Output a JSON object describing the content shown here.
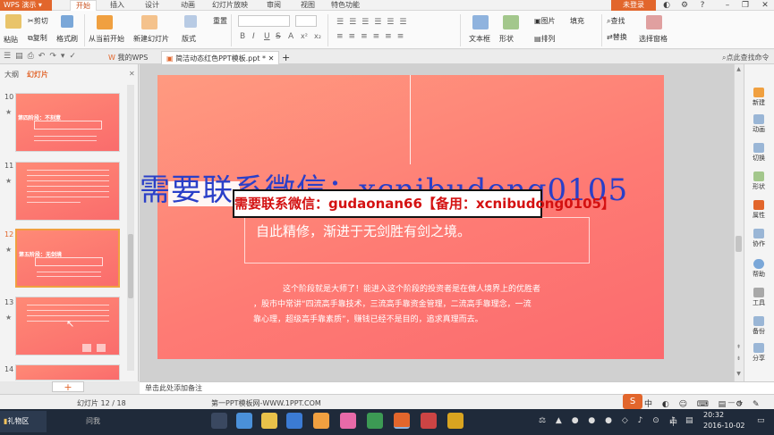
{
  "app": {
    "name": "WPS 演示",
    "menu_tabs": [
      "开始",
      "插入",
      "设计",
      "动画",
      "幻灯片放映",
      "审阅",
      "视图",
      "特色功能"
    ],
    "login_label": "未登录"
  },
  "ribbon": {
    "paste": "粘贴",
    "cut": "剪切",
    "copy": "复制",
    "format_painter": "格式刷",
    "from_current": "从当前开始",
    "new_slide": "新建幻灯片",
    "layout": "版式",
    "reset": "重置",
    "text_box": "文本框",
    "shape": "形状",
    "arrange": "排列",
    "image": "图片",
    "fill": "填充",
    "find": "查找",
    "replace": "替换",
    "select_window": "选择窗格",
    "font_buttons": [
      "B",
      "I",
      "U",
      "S",
      "A",
      "x²",
      "x₂"
    ]
  },
  "quickbar": {
    "tab_my_wps": "我的WPS",
    "tab_doc": "简洁动态红色PPT模板.ppt *",
    "new_tab": "+",
    "right_hint": "点此查找命令"
  },
  "left_panel": {
    "tab_outline": "大纲",
    "tab_slides": "幻灯片",
    "slide_numbers": [
      "10",
      "11",
      "12",
      "13",
      "14"
    ],
    "thumb_titles": [
      "第四阶段：不刻意",
      "第五阶段：无剑境"
    ]
  },
  "slide": {
    "quote": "自此精修，渐进于无剑胜有剑之境。",
    "body_lines": [
      "这个阶段就是大师了！能进入这个阶段的投资者是在做人境界上的优胜者",
      "，股市中常讲“四流高手靠技术，三流高手靠资金管理，二流高手靠理念，一流",
      "靠心理，超级高手靠素质”，赚钱已经不是目的，追求真理而去。"
    ],
    "watermark_big": "需要联系微信：xcnibudong0105",
    "watermark_box": "需要联系微信：gudaonan66【备用：xcnibudong0105】"
  },
  "right_tools": [
    "新建",
    "动画",
    "切换",
    "形状",
    "属性",
    "协作",
    "帮助",
    "工具",
    "备份",
    "分享"
  ],
  "notes_placeholder": "单击此处添加备注",
  "status": {
    "slide_counter": "幻灯片 12 / 18",
    "site": "第一PPT模板网-WWW.1PPT.COM",
    "zoom": "- — +"
  },
  "taskbar": {
    "folder": "礼物区",
    "search": "问我",
    "ime": "中",
    "time": "20:32",
    "date": "2016-10-02"
  }
}
